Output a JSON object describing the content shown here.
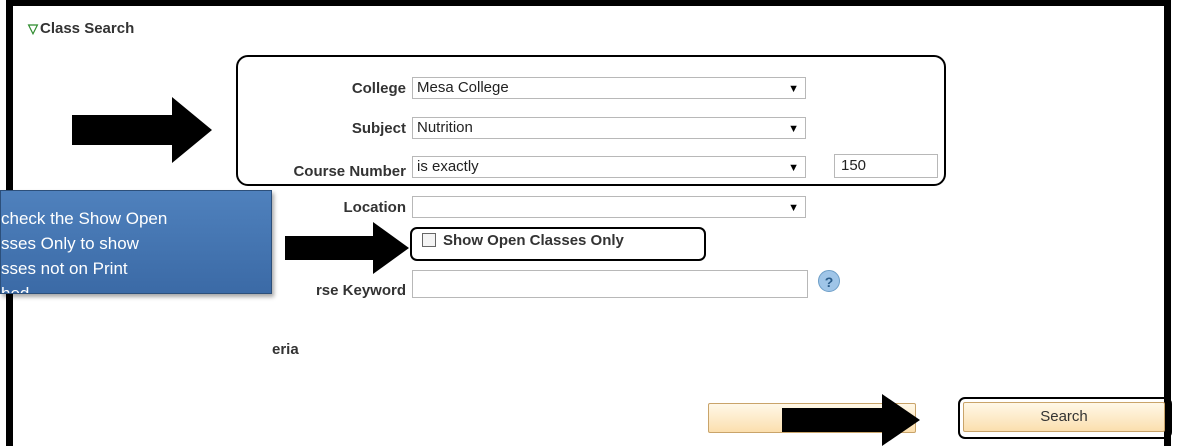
{
  "section": {
    "title": "Class Search"
  },
  "fields": {
    "college": {
      "label": "College",
      "value": "Mesa College"
    },
    "subject": {
      "label": "Subject",
      "value": "Nutrition"
    },
    "course_number": {
      "label": "Course Number",
      "operator": "is exactly",
      "value": "150"
    },
    "location": {
      "label": "Location",
      "value": ""
    },
    "show_open": {
      "label": "Show Open Classes Only",
      "checked": false
    },
    "course_keyword": {
      "label": "rse Keyword",
      "value": ""
    },
    "criteria": {
      "label": "eria"
    }
  },
  "note": {
    "lines": [
      "check the Show Open",
      "sses Only to show",
      "sses not on Print",
      "hed."
    ]
  },
  "buttons": {
    "clear": "",
    "search": "Search"
  },
  "icons": {
    "help": "?",
    "expand": "▽",
    "dropdown": "▼"
  }
}
